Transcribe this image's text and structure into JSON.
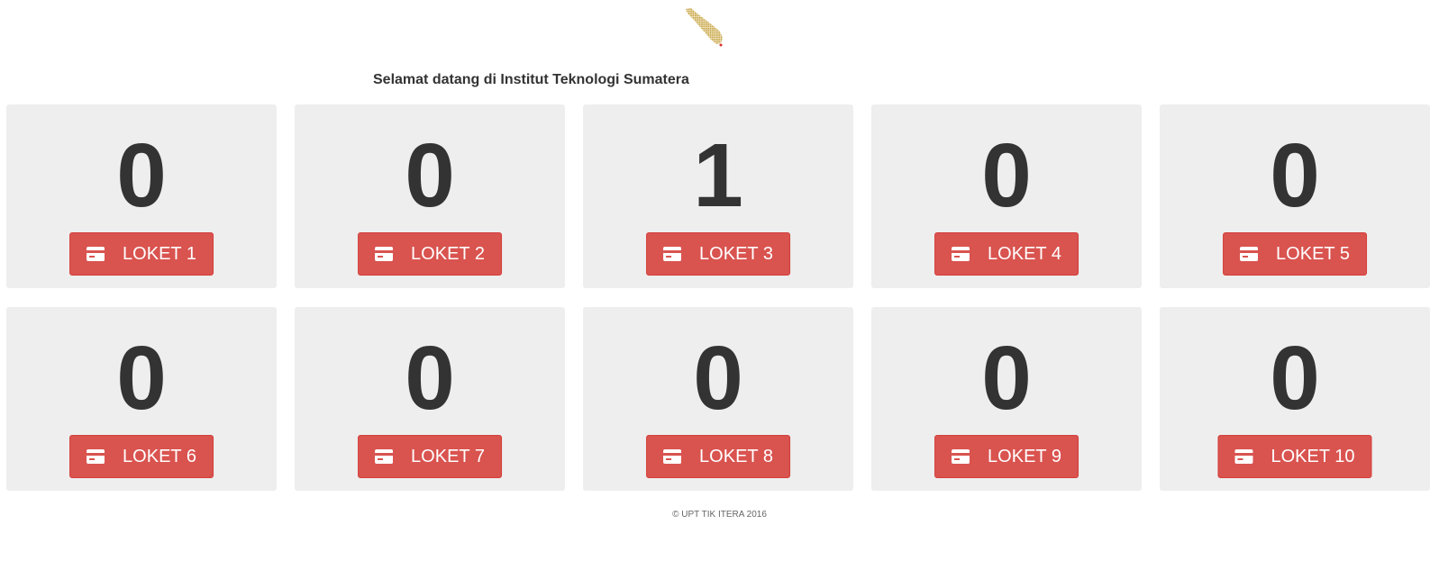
{
  "header": {
    "logo_icon": "itera-logo-icon",
    "welcome_text": "Selamat datang di Institut Teknologi Sumatera"
  },
  "counters": [
    {
      "count": "0",
      "label": "LOKET 1"
    },
    {
      "count": "0",
      "label": "LOKET 2"
    },
    {
      "count": "1",
      "label": "LOKET 3"
    },
    {
      "count": "0",
      "label": "LOKET 4"
    },
    {
      "count": "0",
      "label": "LOKET 5"
    },
    {
      "count": "0",
      "label": "LOKET 6"
    },
    {
      "count": "0",
      "label": "LOKET 7"
    },
    {
      "count": "0",
      "label": "LOKET 8"
    },
    {
      "count": "0",
      "label": "LOKET 9"
    },
    {
      "count": "0",
      "label": "LOKET 10"
    }
  ],
  "button_icon": "credit-card-icon",
  "footer": {
    "text": "© UPT TIK ITERA 2016"
  },
  "colors": {
    "card_bg": "#eeeeee",
    "button_bg": "#d9534f",
    "count_text": "#333333"
  }
}
